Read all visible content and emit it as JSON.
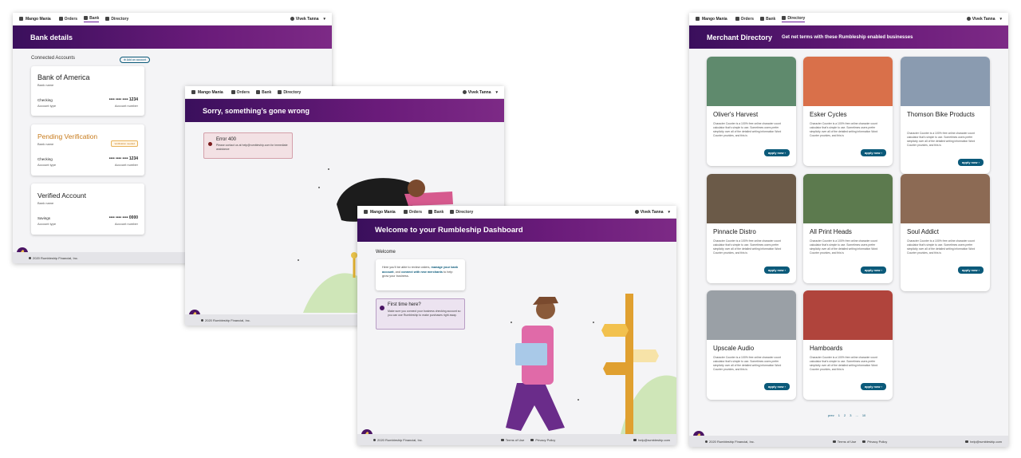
{
  "common": {
    "brand": "Mango Mania",
    "nav": {
      "orders": "Orders",
      "bank": "Bank",
      "directory": "Directory"
    },
    "user": "Vivek Tanna",
    "copyright": "2020 Rumbleship Financial, Inc.",
    "terms": "Terms of Use",
    "privacy": "Privacy Policy",
    "email": "help@rumbleship.com",
    "privacy_cut": "Pri",
    "privacy_cut2": "Pri"
  },
  "bank": {
    "title": "Bank details",
    "connected_label": "Connected Accounts",
    "add_button": "Add an account",
    "accounts": [
      {
        "name": "Bank of America",
        "name_caption": "Bank name",
        "type": "Checking",
        "type_caption": "Account type",
        "number": "•••• •••• •••• 1234",
        "number_caption": "Account number"
      },
      {
        "name": "Pending Verification",
        "name_caption": "Bank name",
        "badge": "Verification needed",
        "type": "Checking",
        "type_caption": "Account type",
        "number": "•••• •••• •••• 1234",
        "number_caption": "Account number"
      },
      {
        "name": "Verified Account",
        "name_caption": "Bank name",
        "type": "Savings",
        "type_caption": "Account type",
        "number": "•••• •••• •••• 0000",
        "number_caption": "Account number"
      }
    ]
  },
  "error_page": {
    "title": "Sorry, something’s gone wrong",
    "error_code": "Error 400",
    "error_message": "Please contact us at help@rumbleship.com for immediate assistance"
  },
  "dashboard": {
    "title": "Welcome to your Rumbleship Dashboard",
    "welcome_label": "Welcome",
    "welcome_text_1": "Here you'll be able to review orders,",
    "welcome_link_1": "manage your bank account",
    "welcome_text_2": ", and",
    "welcome_link_2": "connect with new merchants",
    "welcome_text_3": "to help grow your business.",
    "first_time_title": "First time here?",
    "first_time_text": "Make sure you connect your business checking account so you can use Rumbleship to make purchases right away."
  },
  "directory": {
    "title": "Merchant Directory",
    "subtitle": "Get net terms with these Rumbleship enabled businesses",
    "apply_label": "apply now",
    "description": "Character Counter is a 100% free online character count calculator that's simple to use. Sometimes users prefer simplicity over all of the detailed writing information Word Counter provides, and this is",
    "merchants": [
      {
        "name": "Oliver's Harvest",
        "color": "#5f8a6d"
      },
      {
        "name": "Esker Cycles",
        "color": "#d9704a"
      },
      {
        "name": "Thomson Bike Products",
        "color": "#8a9bb0"
      },
      {
        "name": "Pinnacle Distro",
        "color": "#6b5a48"
      },
      {
        "name": "All Print Heads",
        "color": "#5c7a4e"
      },
      {
        "name": "Soul Addict",
        "color": "#8c6a54"
      },
      {
        "name": "Upscale Audio",
        "color": "#9aa0a6"
      },
      {
        "name": "Hamboards",
        "color": "#b0443c"
      }
    ],
    "pagination": [
      "prev",
      "1",
      "2",
      "3",
      "...",
      "10"
    ]
  },
  "colors": {
    "brand_purple": "#4a1464",
    "accent_teal": "#0b5a7a",
    "pending_orange": "#c77a1a"
  }
}
